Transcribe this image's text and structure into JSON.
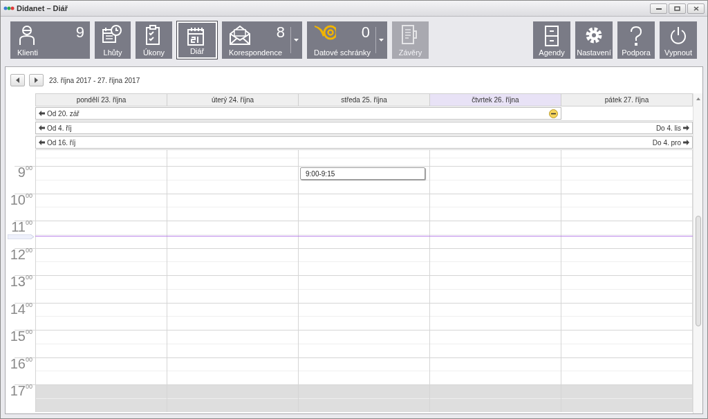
{
  "window": {
    "title": "Didanet – Diář"
  },
  "toolbar": {
    "left_buttons": [
      {
        "label": "Klienti",
        "count": "9",
        "dropdown": false,
        "selected": false,
        "disabled": false
      },
      {
        "label": "Lhůty",
        "dropdown": false,
        "selected": false,
        "disabled": false
      },
      {
        "label": "Úkony",
        "dropdown": false,
        "selected": false,
        "disabled": false
      },
      {
        "label": "Diář",
        "dropdown": false,
        "selected": true,
        "disabled": false
      },
      {
        "label": "Korespondence",
        "count": "8",
        "dropdown": true,
        "selected": false,
        "disabled": false
      },
      {
        "label": "Datové schránky",
        "count": "0",
        "dropdown": true,
        "selected": false,
        "disabled": false
      },
      {
        "label": "Závěry",
        "dropdown": false,
        "selected": false,
        "disabled": true
      }
    ],
    "right_buttons": [
      {
        "label": "Agendy"
      },
      {
        "label": "Nastavení"
      },
      {
        "label": "Podpora"
      },
      {
        "label": "Vypnout"
      }
    ]
  },
  "calendar": {
    "range": "23. října 2017 - 27. října 2017",
    "days": [
      {
        "label": "pondělí 23. října",
        "today": false
      },
      {
        "label": "úterý 24. října",
        "today": false
      },
      {
        "label": "středa 25. října",
        "today": false,
        "events": [
          {
            "time": "9:00-9:15"
          }
        ]
      },
      {
        "label": "čtvrtek 26. října",
        "today": true
      },
      {
        "label": "pátek 27. října",
        "today": false
      }
    ],
    "all_day": [
      {
        "start": "Od 20. zář",
        "covers": [
          true,
          true,
          true,
          true,
          false
        ],
        "marked": true
      },
      {
        "start": "Od 4. říj",
        "end": "Do 4. lis",
        "covers": [
          true,
          true,
          true,
          true,
          true
        ],
        "marked": false
      },
      {
        "start": "Od 16. říj",
        "end": "Do 4. pro",
        "covers": [
          true,
          true,
          true,
          true,
          true
        ],
        "marked": false
      }
    ],
    "hours": [
      {
        "hour": "9",
        "minutes": "00",
        "after_hours": false
      },
      {
        "hour": "10",
        "minutes": "00",
        "after_hours": false
      },
      {
        "hour": "11",
        "minutes": "00",
        "after_hours": false
      },
      {
        "hour": "12",
        "minutes": "00",
        "after_hours": false
      },
      {
        "hour": "13",
        "minutes": "00",
        "after_hours": false
      },
      {
        "hour": "14",
        "minutes": "00",
        "after_hours": false
      },
      {
        "hour": "15",
        "minutes": "00",
        "after_hours": false
      },
      {
        "hour": "16",
        "minutes": "00",
        "after_hours": false
      },
      {
        "hour": "17",
        "minutes": "00",
        "after_hours": true
      }
    ]
  }
}
